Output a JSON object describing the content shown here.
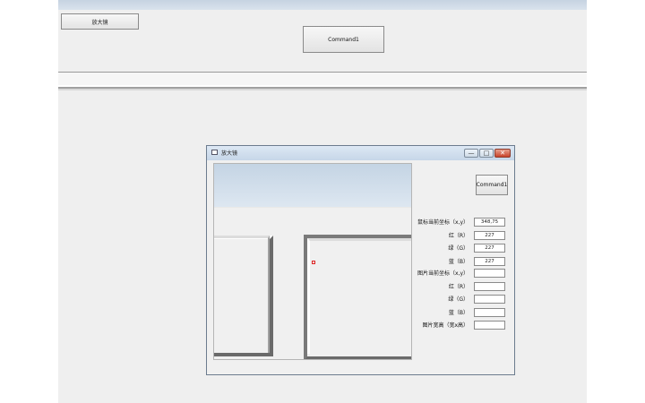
{
  "main": {
    "magnifier_button": "放大镜",
    "command_button": "Command1"
  },
  "window": {
    "title": "放大镜",
    "min_glyph": "—",
    "max_glyph": "□",
    "close_glyph": "✕",
    "command_button": "Command1",
    "fields": [
      {
        "label": "鼠标当前坐标（x,y）",
        "value": "348,75"
      },
      {
        "label": "红（R）",
        "value": "227"
      },
      {
        "label": "绿（G）",
        "value": "227"
      },
      {
        "label": "蓝（B）",
        "value": "227"
      },
      {
        "label": "图片当前坐标（x,y）",
        "value": ""
      },
      {
        "label": "红（R）",
        "value": ""
      },
      {
        "label": "绿（G）",
        "value": ""
      },
      {
        "label": "蓝（B）",
        "value": ""
      },
      {
        "label": "图片宽高（宽x高）",
        "value": ""
      }
    ]
  }
}
